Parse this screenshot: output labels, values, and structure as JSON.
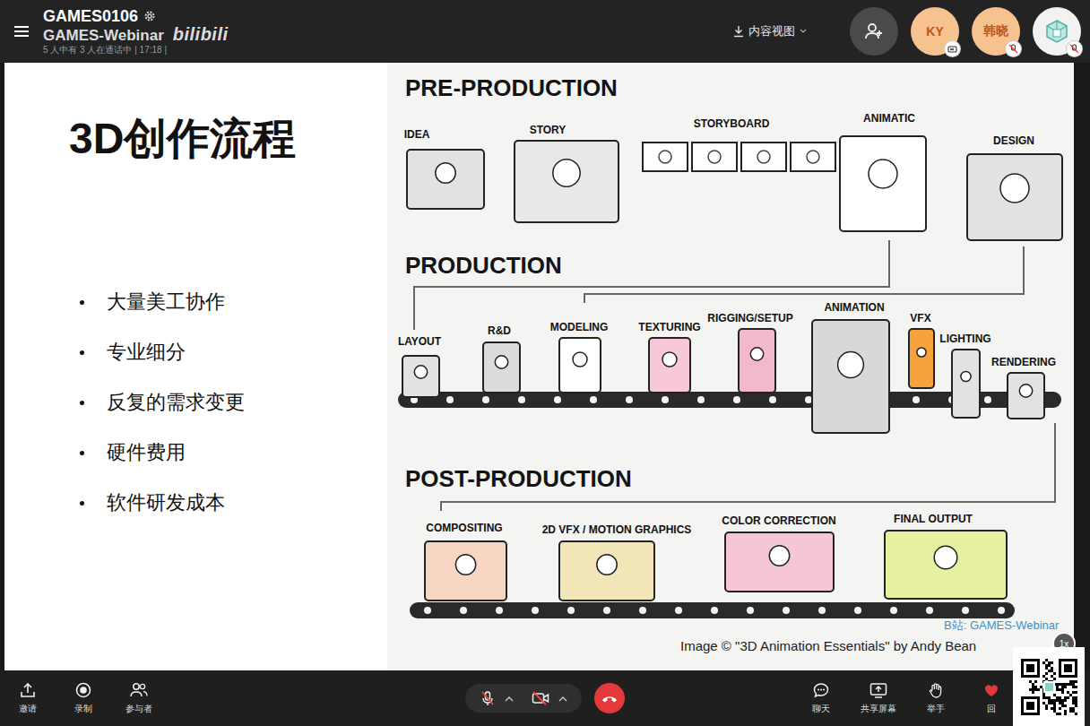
{
  "header": {
    "title": "GAMES0106",
    "watermark": "GAMES-Webinar",
    "watermark_logo": "bilibili",
    "status": "5 人中有 3 人在通话中 | 17:18 |",
    "view_mode": "内容视图"
  },
  "participants": [
    {
      "label": "KY",
      "kind": "text",
      "muted": true
    },
    {
      "label": "韩晓",
      "kind": "text",
      "muted": true
    },
    {
      "kind": "logo",
      "muted": true
    }
  ],
  "slide": {
    "title": "3D创作流程",
    "bullets": [
      "大量美工协作",
      "专业细分",
      "反复的需求变更",
      "硬件费用",
      "软件研发成本"
    ],
    "figure": {
      "sections": [
        {
          "title": "PRE-PRODUCTION",
          "stages": [
            "IDEA",
            "STORY",
            "STORYBOARD",
            "ANIMATIC",
            "DESIGN"
          ]
        },
        {
          "title": "PRODUCTION",
          "stages": [
            "LAYOUT",
            "R&D",
            "MODELING",
            "TEXTURING",
            "RIGGING/SETUP",
            "ANIMATION",
            "VFX",
            "LIGHTING",
            "RENDERING"
          ]
        },
        {
          "title": "POST-PRODUCTION",
          "stages": [
            "COMPOSITING",
            "2D VFX / MOTION GRAPHICS",
            "COLOR CORRECTION",
            "FINAL OUTPUT"
          ]
        }
      ],
      "credit": "Image © \"3D Animation Essentials\" by Andy Bean"
    }
  },
  "player": {
    "watermark": "B站: GAMES-Webinar",
    "speed": "1x"
  },
  "toolbar": {
    "left": [
      "邀请",
      "录制",
      "参与者"
    ],
    "mic": {
      "muted": true
    },
    "camera": {
      "on": false
    },
    "right": [
      "聊天",
      "共享屏幕",
      "举手",
      "回"
    ]
  }
}
